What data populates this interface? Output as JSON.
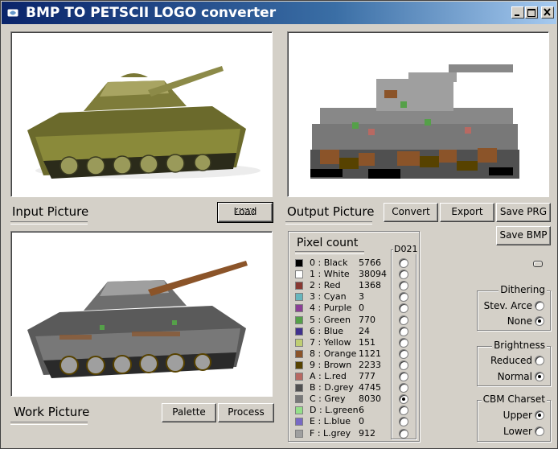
{
  "window": {
    "title": "BMP TO PETSCII LOGO converter",
    "minimize_symbol": "_",
    "maximize_symbol": "□",
    "close_symbol": "✕"
  },
  "labels": {
    "input_picture": "Input Picture",
    "output_picture": "Output Picture",
    "work_picture": "Work Picture"
  },
  "buttons": {
    "load": "Load",
    "convert": "Convert",
    "export": "Export",
    "save_prg": "Save PRG",
    "save_bmp": "Save BMP",
    "palette": "Palette",
    "process": "Process"
  },
  "pixel_count": {
    "title": "Pixel count",
    "d021_label": "D021",
    "rows": [
      {
        "name": "0 : Black",
        "count": "5766",
        "color": "#000000"
      },
      {
        "name": "1 : White",
        "count": "38094",
        "color": "#ffffff"
      },
      {
        "name": "2 : Red",
        "count": "1368",
        "color": "#883932"
      },
      {
        "name": "3 : Cyan",
        "count": "3",
        "color": "#67b6bd"
      },
      {
        "name": "4 : Purple",
        "count": "0",
        "color": "#8b3f96"
      },
      {
        "name": "5 : Green",
        "count": "770",
        "color": "#55a049"
      },
      {
        "name": "6 : Blue",
        "count": "24",
        "color": "#40318d"
      },
      {
        "name": "7 : Yellow",
        "count": "151",
        "color": "#bfce72"
      },
      {
        "name": "8 : Orange",
        "count": "1121",
        "color": "#8b5429"
      },
      {
        "name": "9 : Brown",
        "count": "2233",
        "color": "#574200"
      },
      {
        "name": "A : L.red",
        "count": "777",
        "color": "#b86962"
      },
      {
        "name": "B : D.grey",
        "count": "4745",
        "color": "#505050"
      },
      {
        "name": "C : Grey",
        "count": "8030",
        "color": "#787878"
      },
      {
        "name": "D : L.green",
        "count": "6",
        "color": "#94e089"
      },
      {
        "name": "E : L.blue",
        "count": "0",
        "color": "#7869c4"
      },
      {
        "name": "F : L.grey",
        "count": "912",
        "color": "#9f9f9f"
      }
    ],
    "d021_selected_index": 12
  },
  "dithering": {
    "title": "Dithering",
    "options": [
      "Stev. Arce",
      "None"
    ],
    "selected": "None"
  },
  "brightness": {
    "title": "Brightness",
    "options": [
      "Reduced",
      "Normal"
    ],
    "selected": "Normal"
  },
  "cbm_charset": {
    "title": "CBM Charset",
    "options": [
      "Upper",
      "Lower"
    ],
    "selected": "Upper"
  }
}
